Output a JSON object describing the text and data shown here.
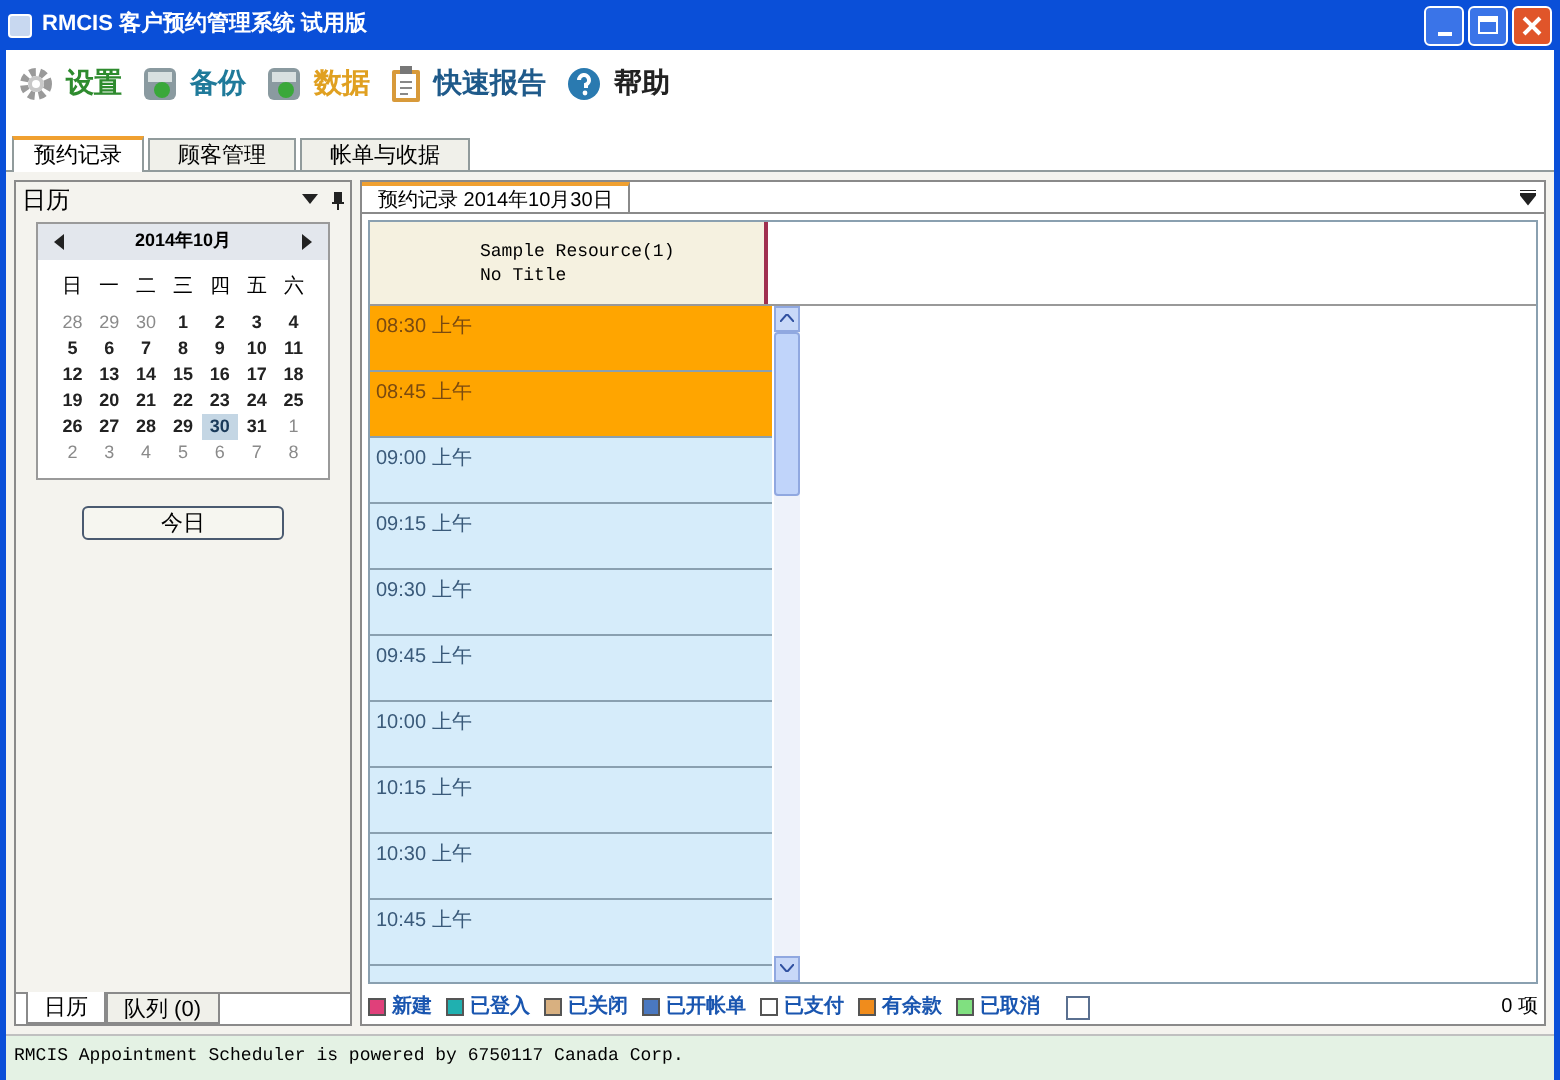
{
  "window": {
    "title": "RMCIS 客户预约管理系统 试用版"
  },
  "toolbar": [
    {
      "label": "设置",
      "kind": "gear",
      "color": "#2e8b2e"
    },
    {
      "label": "备份",
      "kind": "disk",
      "color": "#1f7a9a"
    },
    {
      "label": "数据",
      "kind": "disk",
      "color": "#e0a020"
    },
    {
      "label": "快速报告",
      "kind": "clipboard",
      "color": "#1f5a8a"
    },
    {
      "label": "帮助",
      "kind": "help",
      "color": "#222222"
    }
  ],
  "tabs": [
    {
      "label": "预约记录",
      "selected": true
    },
    {
      "label": "顾客管理",
      "selected": false
    },
    {
      "label": "帐单与收据",
      "selected": false
    }
  ],
  "sidebar": {
    "title": "日历",
    "calendar": {
      "month": "2014年10月",
      "weekdays": [
        "日",
        "一",
        "二",
        "三",
        "四",
        "五",
        "六"
      ],
      "weeks": [
        [
          {
            "day": "28",
            "other_month": true,
            "selected": false
          },
          {
            "day": "29",
            "other_month": true,
            "selected": false
          },
          {
            "day": "30",
            "other_month": true,
            "selected": false
          },
          {
            "day": "1",
            "other_month": false,
            "selected": false
          },
          {
            "day": "2",
            "other_month": false,
            "selected": false
          },
          {
            "day": "3",
            "other_month": false,
            "selected": false
          },
          {
            "day": "4",
            "other_month": false,
            "selected": false
          }
        ],
        [
          {
            "day": "5",
            "other_month": false,
            "selected": false
          },
          {
            "day": "6",
            "other_month": false,
            "selected": false
          },
          {
            "day": "7",
            "other_month": false,
            "selected": false
          },
          {
            "day": "8",
            "other_month": false,
            "selected": false
          },
          {
            "day": "9",
            "other_month": false,
            "selected": false
          },
          {
            "day": "10",
            "other_month": false,
            "selected": false
          },
          {
            "day": "11",
            "other_month": false,
            "selected": false
          }
        ],
        [
          {
            "day": "12",
            "other_month": false,
            "selected": false
          },
          {
            "day": "13",
            "other_month": false,
            "selected": false
          },
          {
            "day": "14",
            "other_month": false,
            "selected": false
          },
          {
            "day": "15",
            "other_month": false,
            "selected": false
          },
          {
            "day": "16",
            "other_month": false,
            "selected": false
          },
          {
            "day": "17",
            "other_month": false,
            "selected": false
          },
          {
            "day": "18",
            "other_month": false,
            "selected": false
          }
        ],
        [
          {
            "day": "19",
            "other_month": false,
            "selected": false
          },
          {
            "day": "20",
            "other_month": false,
            "selected": false
          },
          {
            "day": "21",
            "other_month": false,
            "selected": false
          },
          {
            "day": "22",
            "other_month": false,
            "selected": false
          },
          {
            "day": "23",
            "other_month": false,
            "selected": false
          },
          {
            "day": "24",
            "other_month": false,
            "selected": false
          },
          {
            "day": "25",
            "other_month": false,
            "selected": false
          }
        ],
        [
          {
            "day": "26",
            "other_month": false,
            "selected": false
          },
          {
            "day": "27",
            "other_month": false,
            "selected": false
          },
          {
            "day": "28",
            "other_month": false,
            "selected": false
          },
          {
            "day": "29",
            "other_month": false,
            "selected": false
          },
          {
            "day": "30",
            "other_month": false,
            "selected": true
          },
          {
            "day": "31",
            "other_month": false,
            "selected": false
          },
          {
            "day": "1",
            "other_month": true,
            "selected": false
          }
        ],
        [
          {
            "day": "2",
            "other_month": true,
            "selected": false
          },
          {
            "day": "3",
            "other_month": true,
            "selected": false
          },
          {
            "day": "4",
            "other_month": true,
            "selected": false
          },
          {
            "day": "5",
            "other_month": true,
            "selected": false
          },
          {
            "day": "6",
            "other_month": true,
            "selected": false
          },
          {
            "day": "7",
            "other_month": true,
            "selected": false
          },
          {
            "day": "8",
            "other_month": true,
            "selected": false
          }
        ]
      ]
    },
    "today_button": "今日",
    "bottom_tabs": [
      {
        "label": "日历",
        "selected": true
      },
      {
        "label": "队列 (0)",
        "selected": false
      }
    ]
  },
  "schedule": {
    "tab": "预约记录 2014年10月30日",
    "resource": "Sample Resource(1)",
    "resource_title": "No Title",
    "slots": [
      {
        "time": "08:30 上午",
        "booked": true
      },
      {
        "time": "08:45 上午",
        "booked": true
      },
      {
        "time": "09:00 上午",
        "booked": false
      },
      {
        "time": "09:15 上午",
        "booked": false
      },
      {
        "time": "09:30 上午",
        "booked": false
      },
      {
        "time": "09:45 上午",
        "booked": false
      },
      {
        "time": "10:00 上午",
        "booked": false
      },
      {
        "time": "10:15 上午",
        "booked": false
      },
      {
        "time": "10:30 上午",
        "booked": false
      },
      {
        "time": "10:45 上午",
        "booked": false
      }
    ],
    "legend": [
      {
        "label": "新建",
        "color": "#e0407a"
      },
      {
        "label": "已登入",
        "color": "#20b0b0"
      },
      {
        "label": "已关闭",
        "color": "#d8b080"
      },
      {
        "label": "已开帐单",
        "color": "#4a78c0"
      },
      {
        "label": "已支付",
        "color": "#ffffff"
      },
      {
        "label": "有余款",
        "color": "#f08c1c"
      },
      {
        "label": "已取消",
        "color": "#80e080"
      }
    ],
    "legend_checkbox": {
      "checked": false
    },
    "count": "0 项"
  },
  "status_bar": "RMCIS Appointment Scheduler is powered by 6750117 Canada Corp."
}
